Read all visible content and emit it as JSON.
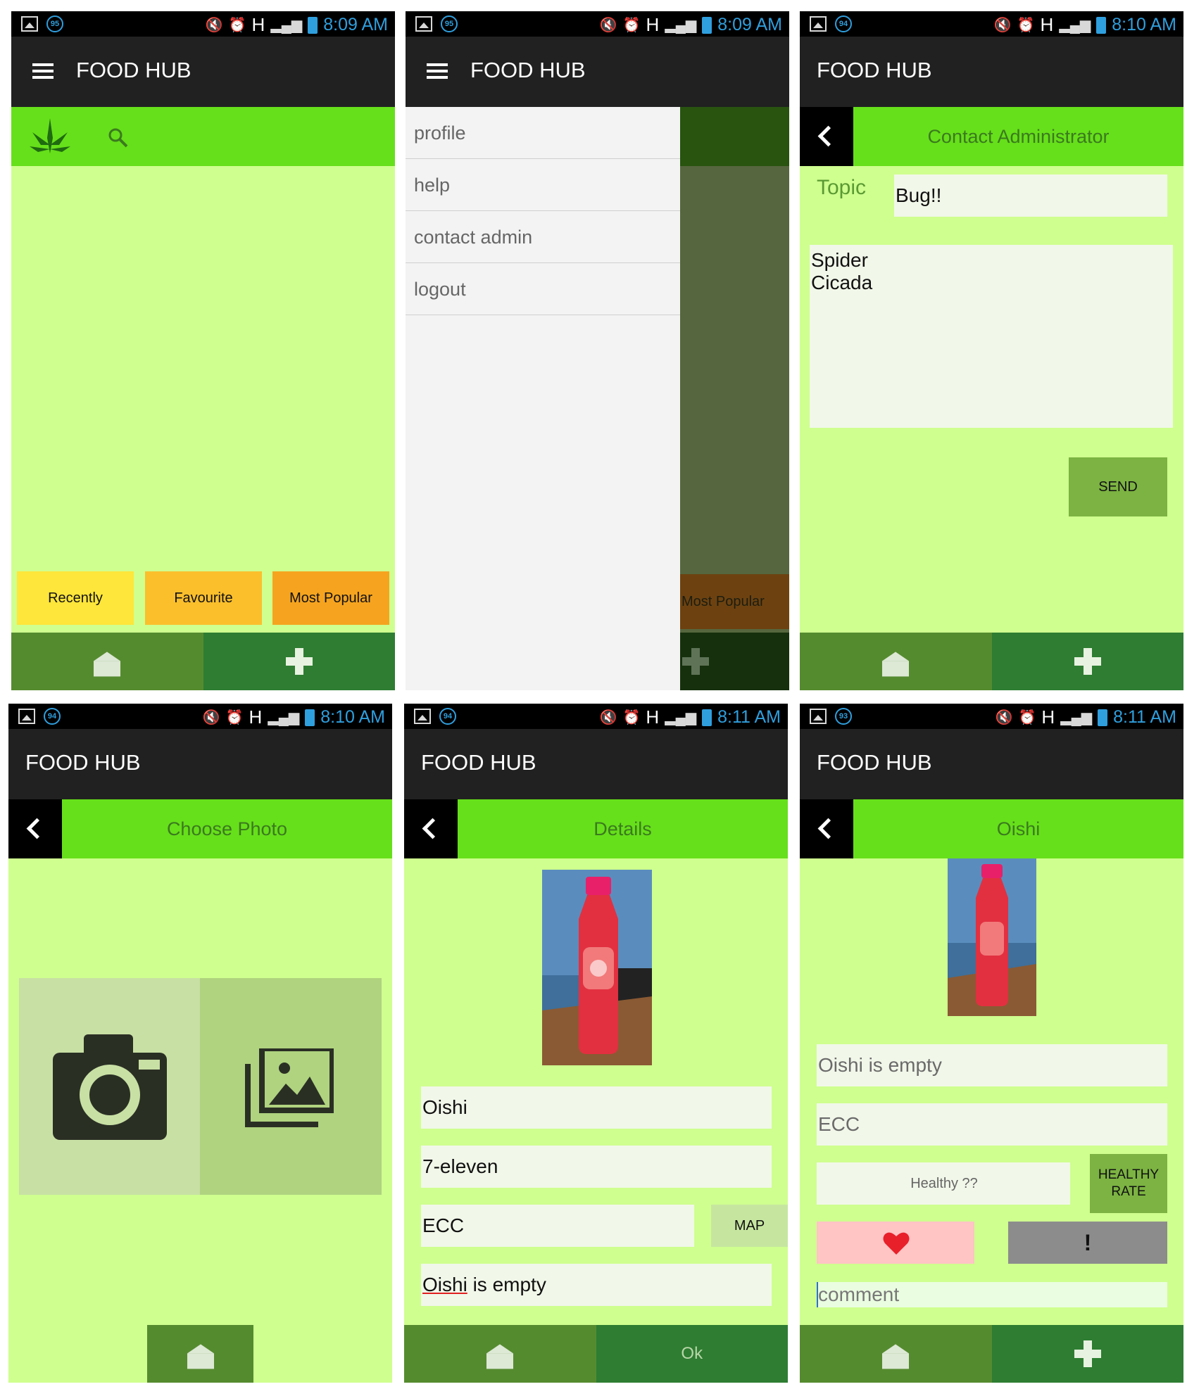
{
  "app": {
    "title": "FOOD HUB"
  },
  "status": {
    "s1": {
      "badge": "95",
      "time": "8:09 AM"
    },
    "s2": {
      "badge": "95",
      "time": "8:09 AM"
    },
    "s3": {
      "badge": "94",
      "time": "8:10 AM"
    },
    "s4": {
      "badge": "94",
      "time": "8:10 AM"
    },
    "s5": {
      "badge": "94",
      "time": "8:11 AM"
    },
    "s6": {
      "badge": "93",
      "time": "8:11 AM"
    },
    "network": "H"
  },
  "home": {
    "tabs": [
      {
        "label": "Recently",
        "color": "#ffe63a"
      },
      {
        "label": "Favourite",
        "color": "#fbbf2c"
      },
      {
        "label": "Most Popular",
        "color": "#f6a41f"
      }
    ]
  },
  "drawer": {
    "items": [
      "profile",
      "help",
      "contact admin",
      "logout"
    ],
    "behind_label": "Most Popular"
  },
  "contact": {
    "title": "Contact Administrator",
    "topic_label": "Topic",
    "topic_value": "Bug!!",
    "message_line1": "Spider",
    "message_line2": "Cicada",
    "send_label": "SEND"
  },
  "choose_photo": {
    "title": "Choose Photo"
  },
  "details": {
    "title": "Details",
    "name": "Oishi",
    "store": "7-eleven",
    "location": "ECC",
    "map_label": "MAP",
    "comment_word": "Oishi",
    "comment_rest": " is empty",
    "ok_label": "Ok"
  },
  "item": {
    "title": "Oishi",
    "comment": "Oishi is empty",
    "location": "ECC",
    "healthy_placeholder": "Healthy ??",
    "rate_line1": "HEALTHY",
    "rate_line2": "RATE",
    "exclaim": "!",
    "comment_placeholder": "comment"
  },
  "colors": {
    "background": "#cfff8f",
    "accent": "#66e01a",
    "appbar": "#212121",
    "home_button": "#558b2f",
    "add_button": "#2e7d32",
    "like_button": "#ffc4c4",
    "report_button": "#8c8c8c"
  },
  "icons": [
    "menu-icon",
    "leaf-logo-icon",
    "search-icon",
    "back-icon",
    "home-icon",
    "plus-icon",
    "camera-icon",
    "gallery-icon",
    "heart-icon"
  ]
}
